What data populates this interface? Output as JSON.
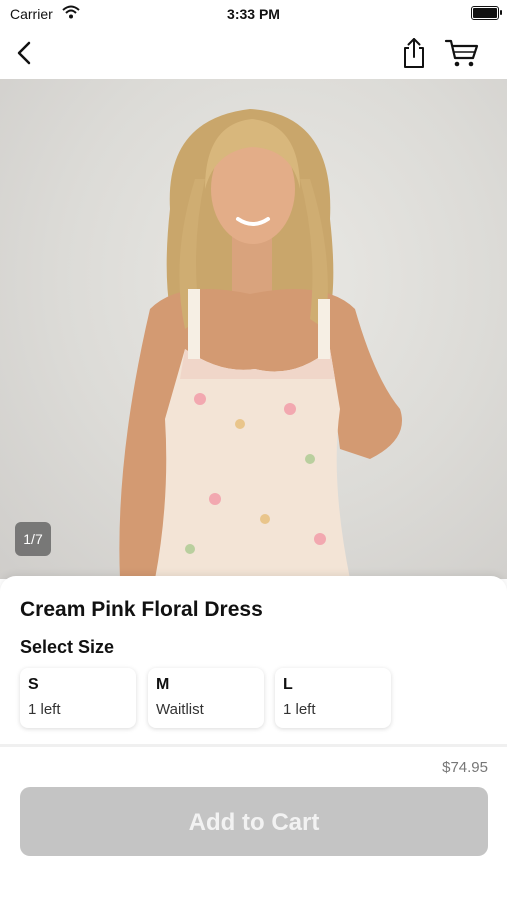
{
  "status_bar": {
    "carrier": "Carrier",
    "time": "3:33 PM"
  },
  "nav": {
    "back_icon": "chevron-left-icon",
    "share_icon": "share-icon",
    "cart_icon": "cart-icon"
  },
  "gallery": {
    "page_indicator": "1/7"
  },
  "product": {
    "title": "Cream Pink Floral Dress",
    "select_size_label": "Select Size",
    "sizes": [
      {
        "name": "S",
        "stock": "1 left"
      },
      {
        "name": "M",
        "stock": "Waitlist"
      },
      {
        "name": "L",
        "stock": "1 left"
      }
    ],
    "price": "$74.95",
    "add_to_cart_label": "Add to Cart"
  },
  "colors": {
    "button_disabled": "#c4c4c4",
    "price_text": "#777777"
  }
}
